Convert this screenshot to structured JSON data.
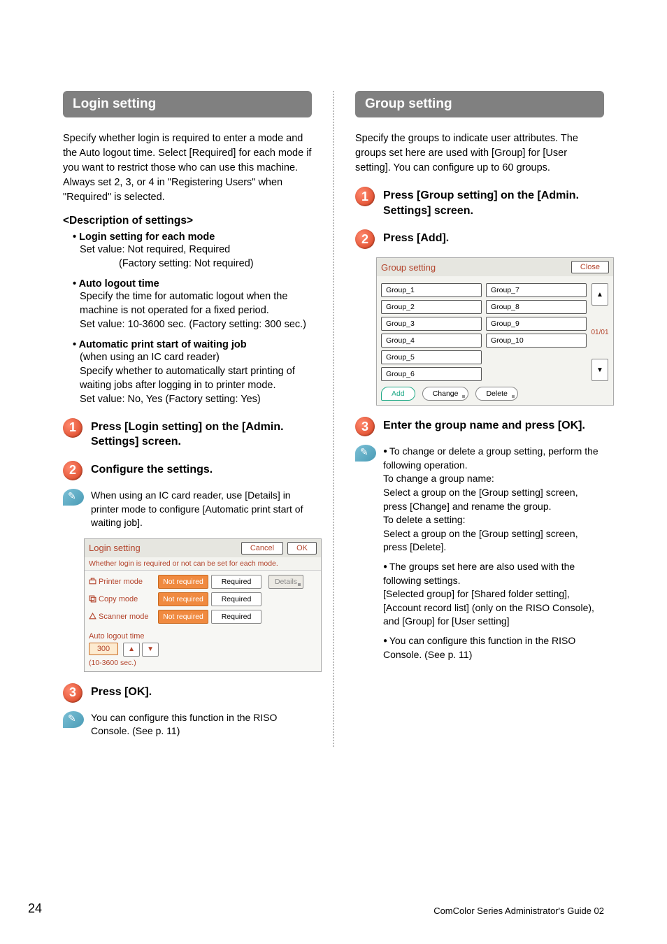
{
  "left": {
    "heading": "Login setting",
    "intro": "Specify whether login is required to enter a mode and the Auto logout time. Select [Required] for each mode if you want to restrict those who can use this machine. Always set 2, 3, or 4 in \"Registering Users\" when \"Required\" is selected.",
    "desc_head": "<Description of settings>",
    "b1_label": "Login setting for each mode",
    "b1_line1": "Set value: Not required, Required",
    "b1_line2": "(Factory setting: Not required)",
    "b2_label": "Auto logout time",
    "b2_line1": "Specify the time for automatic logout when the machine is not operated for a fixed period.",
    "b2_line2": "Set value: 10-3600 sec. (Factory setting: 300 sec.)",
    "b3_label": "Automatic print start of waiting job",
    "b3_line0": "(when using an IC card reader)",
    "b3_line1": "Specify whether to automatically start printing of waiting jobs after logging in to printer mode.",
    "b3_line2": "Set value: No, Yes (Factory setting: Yes)",
    "step1": "Press [Login setting] on the [Admin. Settings] screen.",
    "step2": "Configure the settings.",
    "step3": "Press [OK].",
    "note1": "When using an IC card reader, use [Details] in printer mode to configure [Automatic print start of waiting job].",
    "note2": "You can configure this function in the RISO Console. (See p. 11)",
    "dlg": {
      "title": "Login setting",
      "cancel": "Cancel",
      "ok": "OK",
      "sub": "Whether login is required or not can be set for each mode.",
      "printer": "Printer mode",
      "copy": "Copy mode",
      "scanner": "Scanner mode",
      "notreq": "Not required",
      "req": "Required",
      "details": "Details",
      "logout_label": "Auto logout time",
      "logout_val": "300",
      "range": "(10-3600 sec.)"
    }
  },
  "right": {
    "heading": "Group setting",
    "intro": "Specify the groups to indicate user attributes. The groups set here are used with [Group] for [User setting]. You can configure up to 60 groups.",
    "step1": "Press [Group setting] on the [Admin. Settings] screen.",
    "step2": "Press [Add].",
    "step3": "Enter the group name and press [OK].",
    "dlg": {
      "title": "Group setting",
      "close": "Close",
      "page": "01/01",
      "items": [
        "Group_1",
        "Group_2",
        "Group_3",
        "Group_4",
        "Group_5",
        "Group_6",
        "Group_7",
        "Group_8",
        "Group_9",
        "Group_10"
      ],
      "add": "Add",
      "change": "Change",
      "delete": "Delete"
    },
    "note": {
      "b1a": "To change or delete a group setting, perform the following operation.",
      "b1b": "To change a group name:",
      "b1c": "Select a group on the [Group setting] screen, press [Change] and rename the group.",
      "b1d": "To delete a setting:",
      "b1e": "Select a group on the [Group setting] screen, press [Delete].",
      "b2a": "The groups set here are also used with the following settings.",
      "b2b": "[Selected group] for [Shared folder setting], [Account record list] (only on the RISO Console), and [Group] for [User setting]",
      "b3": "You can configure this function in the RISO Console. (See p. 11)"
    }
  },
  "page_number": "24",
  "footer": "ComColor Series  Administrator's Guide 02"
}
